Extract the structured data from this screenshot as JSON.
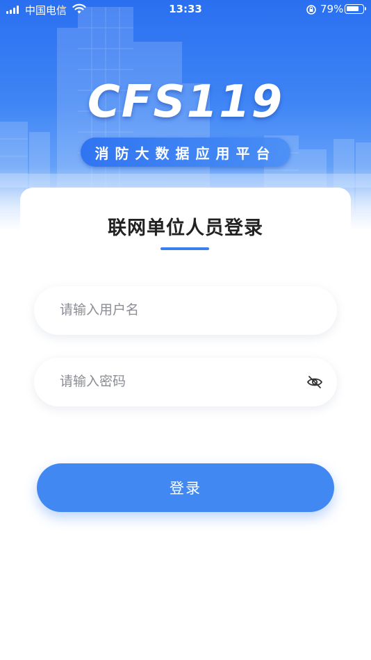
{
  "status_bar": {
    "carrier": "中国电信",
    "time": "13:33",
    "battery_percent": "79%",
    "battery_level": 0.79,
    "icons": [
      "signal-icon",
      "wifi-icon",
      "rotation-lock-icon",
      "battery-icon"
    ]
  },
  "hero": {
    "title": "CFS119",
    "subtitle": "消防大数据应用平台"
  },
  "login_card": {
    "title": "联网单位人员登录",
    "username_placeholder": "请输入用户名",
    "password_placeholder": "请输入密码",
    "password_toggle_icon": "eye-off-icon",
    "login_button_label": "登录"
  },
  "colors": {
    "primary": "#4288f2",
    "accent_underline": "#3a7ff0",
    "hero_top": "#2a6ff0",
    "text_dark": "#222222",
    "placeholder": "#8a8d94"
  }
}
